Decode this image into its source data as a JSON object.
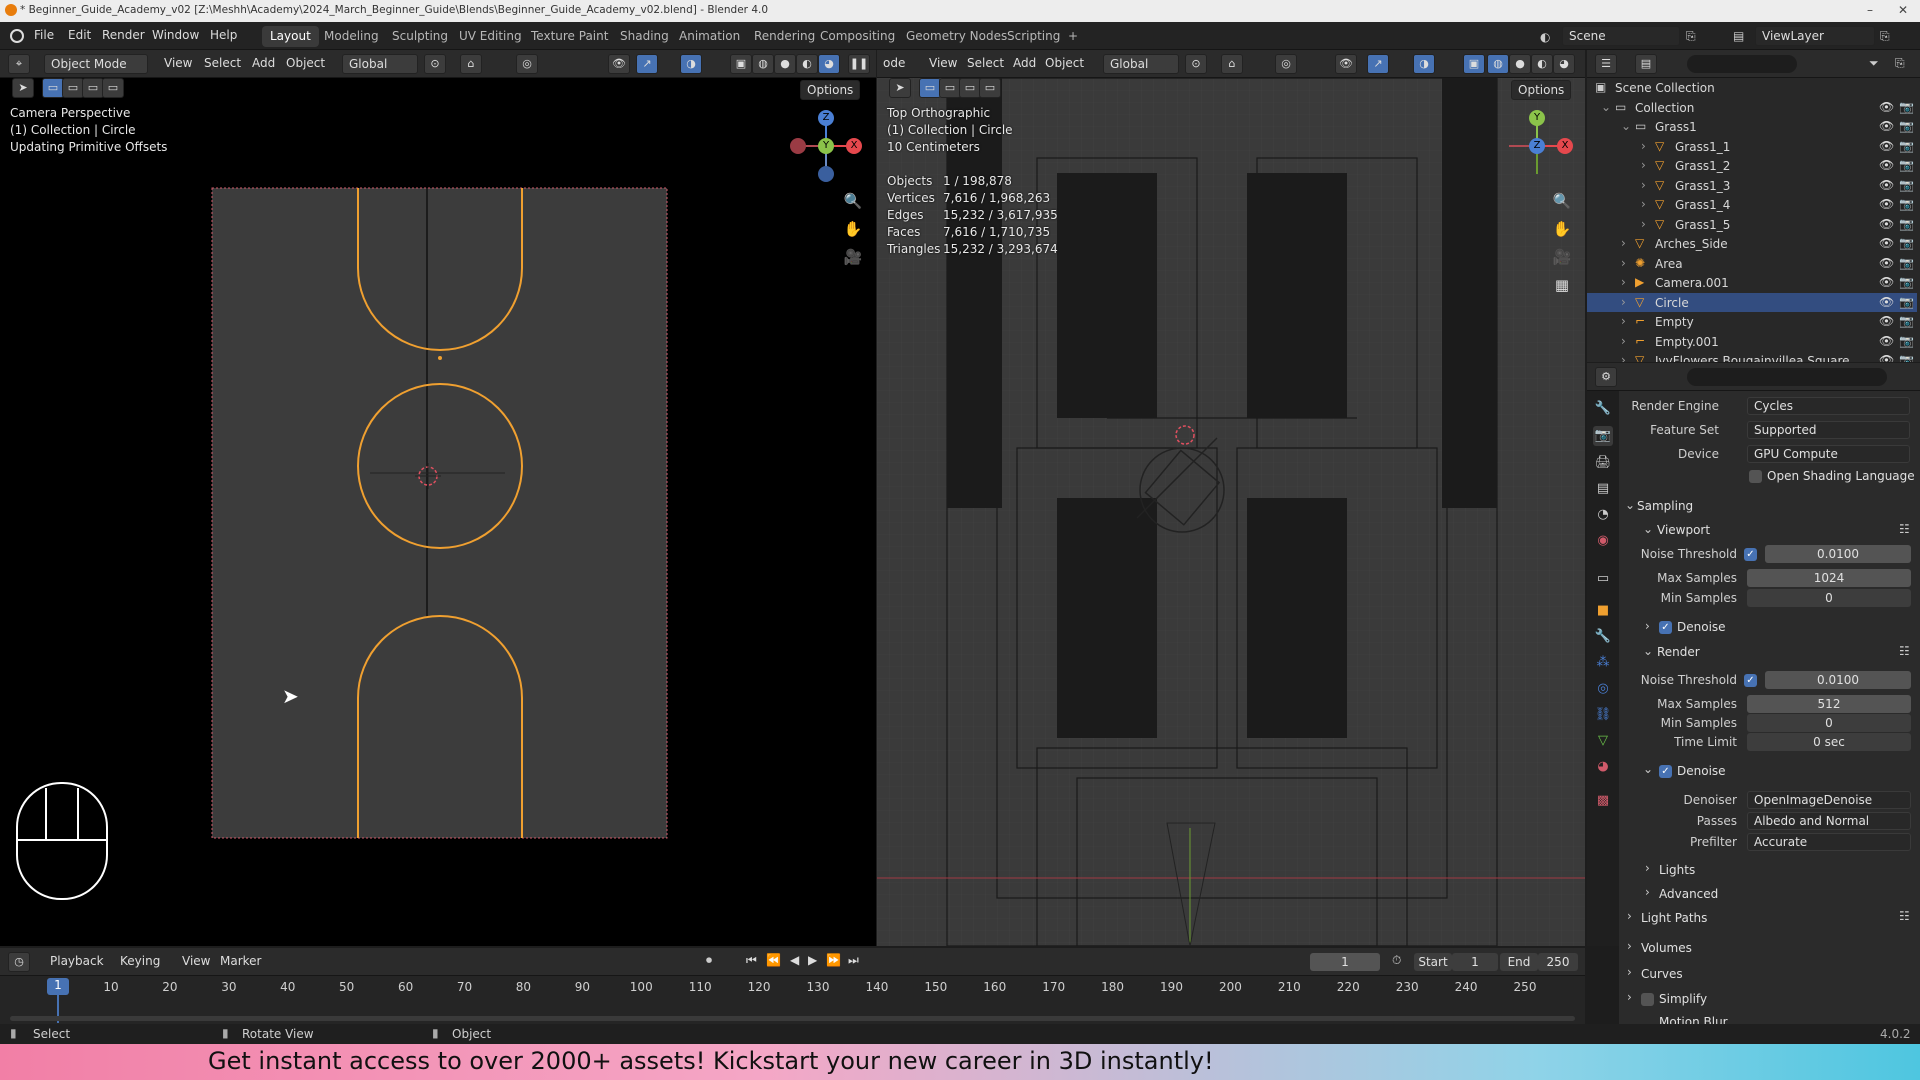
{
  "window": {
    "title": "* Beginner_Guide_Academy_v02 [Z:\\Meshh\\Academy\\2024_March_Beginner_Guide\\Blends\\Beginner_Guide_Academy_v02.blend] - Blender 4.0",
    "minimize": "–",
    "maximize": "□",
    "close": "✕"
  },
  "menu": {
    "file": "File",
    "edit": "Edit",
    "render": "Render",
    "window": "Window",
    "help": "Help"
  },
  "workspaces": [
    "Layout",
    "Modeling",
    "Sculpting",
    "UV Editing",
    "Texture Paint",
    "Shading",
    "Animation",
    "Rendering",
    "Compositing",
    "Geometry Nodes",
    "Scripting"
  ],
  "topbar": {
    "add_tab": "+",
    "scene": "Scene",
    "view_layer": "ViewLayer"
  },
  "left_viewport": {
    "mode": "Object Mode",
    "view": "View",
    "select": "Select",
    "add": "Add",
    "object": "Object",
    "transform": "Global",
    "options": "Options",
    "overlay_lines": [
      "Camera Perspective",
      "(1) Collection | Circle",
      "Updating Primitive Offsets"
    ]
  },
  "right_viewport": {
    "mode": "ode",
    "view": "View",
    "select": "Select",
    "add": "Add",
    "object": "Object",
    "transform": "Global",
    "options": "Options",
    "overlay_lines": [
      "Top Orthographic",
      "(1) Collection | Circle",
      "10 Centimeters"
    ],
    "stats": [
      {
        "label": "Objects",
        "value": "1 / 198,878"
      },
      {
        "label": "Vertices",
        "value": "7,616 / 1,968,263"
      },
      {
        "label": "Edges",
        "value": "15,232 / 3,617,935"
      },
      {
        "label": "Faces",
        "value": "7,616 / 1,710,735"
      },
      {
        "label": "Triangles",
        "value": "15,232 / 3,293,674"
      }
    ]
  },
  "gizmo": {
    "x": "X",
    "y": "Y",
    "z": "Z"
  },
  "outliner": {
    "rows": [
      {
        "name": "Scene Collection",
        "indent": 0,
        "icon": "scene-collection-icon",
        "selected": false
      },
      {
        "name": "Collection",
        "indent": 1,
        "icon": "collection-icon",
        "selected": false
      },
      {
        "name": "Grass1",
        "indent": 2,
        "icon": "collection-icon",
        "selected": false
      },
      {
        "name": "Grass1_1",
        "indent": 3,
        "icon": "mesh-icon",
        "selected": false
      },
      {
        "name": "Grass1_2",
        "indent": 3,
        "icon": "mesh-icon",
        "selected": false
      },
      {
        "name": "Grass1_3",
        "indent": 3,
        "icon": "mesh-icon",
        "selected": false
      },
      {
        "name": "Grass1_4",
        "indent": 3,
        "icon": "mesh-icon",
        "selected": false
      },
      {
        "name": "Grass1_5",
        "indent": 3,
        "icon": "mesh-icon",
        "selected": false
      },
      {
        "name": "Arches_Side",
        "indent": 2,
        "icon": "mesh-icon",
        "selected": false
      },
      {
        "name": "Area",
        "indent": 2,
        "icon": "light-icon",
        "selected": false
      },
      {
        "name": "Camera.001",
        "indent": 2,
        "icon": "camera-icon",
        "selected": false
      },
      {
        "name": "Circle",
        "indent": 2,
        "icon": "mesh-icon",
        "selected": true
      },
      {
        "name": "Empty",
        "indent": 2,
        "icon": "empty-icon",
        "selected": false
      },
      {
        "name": "Empty.001",
        "indent": 2,
        "icon": "empty-icon",
        "selected": false
      },
      {
        "name": "IvyFlowers Bougainvillea Square",
        "indent": 2,
        "icon": "mesh-icon",
        "selected": false
      }
    ]
  },
  "properties": {
    "render_engine": {
      "label": "Render Engine",
      "value": "Cycles"
    },
    "feature_set": {
      "label": "Feature Set",
      "value": "Supported"
    },
    "device": {
      "label": "Device",
      "value": "GPU Compute"
    },
    "osl": "Open Shading Language",
    "sampling": "Sampling",
    "viewport": "Viewport",
    "vp_noise": {
      "label": "Noise Threshold",
      "value": "0.0100"
    },
    "vp_max": {
      "label": "Max Samples",
      "value": "1024"
    },
    "vp_min": {
      "label": "Min Samples",
      "value": "0"
    },
    "vp_denoise": "Denoise",
    "render": "Render",
    "r_noise": {
      "label": "Noise Threshold",
      "value": "0.0100"
    },
    "r_max": {
      "label": "Max Samples",
      "value": "512"
    },
    "r_min": {
      "label": "Min Samples",
      "value": "0"
    },
    "r_time": {
      "label": "Time Limit",
      "value": "0 sec"
    },
    "r_denoise": "Denoise",
    "denoiser": {
      "label": "Denoiser",
      "value": "OpenImageDenoise"
    },
    "passes": {
      "label": "Passes",
      "value": "Albedo and Normal"
    },
    "prefilter": {
      "label": "Prefilter",
      "value": "Accurate"
    },
    "lights": "Lights",
    "advanced": "Advanced",
    "light_paths": "Light Paths",
    "volumes": "Volumes",
    "curves": "Curves",
    "simplify": "Simplify",
    "motion_blur": "Motion Blur"
  },
  "timeline": {
    "playback": "Playback",
    "keying": "Keying",
    "view": "View",
    "marker": "Marker",
    "current_frame": "1",
    "start_label": "Start",
    "start": "1",
    "end_label": "End",
    "end": "250",
    "ticks": [
      "10",
      "20",
      "30",
      "40",
      "50",
      "60",
      "70",
      "80",
      "90",
      "100",
      "110",
      "120",
      "130",
      "140",
      "150",
      "160",
      "170",
      "180",
      "190",
      "200",
      "210",
      "220",
      "230",
      "240",
      "250"
    ],
    "playhead": "1"
  },
  "statusbar": {
    "select": "Select",
    "rotate": "Rotate View",
    "object": "Object",
    "version": "4.0.2"
  },
  "banner": {
    "text": "Get instant access to over 2000+ assets! Kickstart your new career in 3D instantly!"
  },
  "colors": {
    "accent": "#4772b3",
    "selection_orange": "#f0a030",
    "outliner_selected": "#334d80",
    "axis_x": "#e5484d",
    "axis_y": "#8bc34a",
    "axis_z": "#4a7fd4"
  }
}
